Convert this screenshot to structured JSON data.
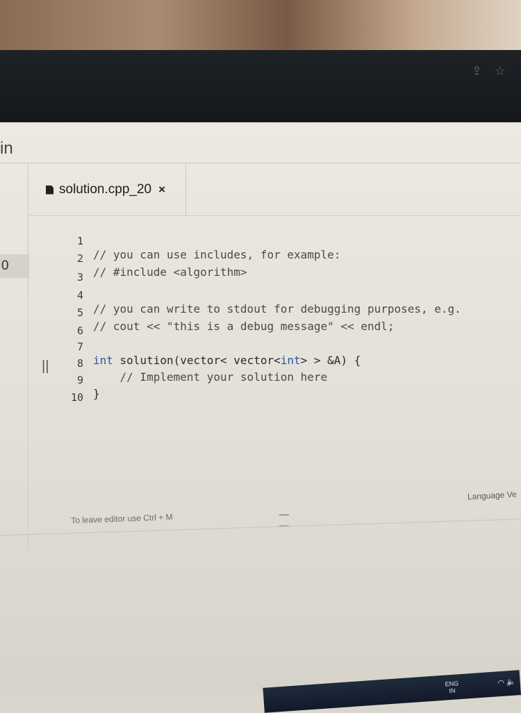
{
  "browser": {
    "share_icon": "share-icon",
    "star_icon": "star-icon"
  },
  "left_panel": {
    "edge_text": "in",
    "count": "0"
  },
  "editor": {
    "tab": {
      "label": "solution.cpp_20",
      "close": "×"
    },
    "lines": [
      {
        "num": "1",
        "text": "// you can use includes, for example:"
      },
      {
        "num": "2",
        "text": "// #include <algorithm>"
      },
      {
        "num": "3",
        "text": ""
      },
      {
        "num": "4",
        "text": "// you can write to stdout for debugging purposes, e.g."
      },
      {
        "num": "5",
        "text": "// cout << \"this is a debug message\" << endl;"
      },
      {
        "num": "6",
        "text": ""
      },
      {
        "num": "7",
        "text_kw1": "int",
        "text_mid": " solution(vector< vector<",
        "text_kw2": "int",
        "text_end": "> > &A) {"
      },
      {
        "num": "8",
        "text": "    // Implement your solution here"
      },
      {
        "num": "9",
        "text": "}"
      },
      {
        "num": "10",
        "text": ""
      }
    ],
    "hint": "To leave editor use Ctrl + M",
    "language_label": "Language Ve"
  },
  "taskbar": {
    "lang_line1": "ENG",
    "lang_line2": "IN",
    "icons": "wifi-icon volume-icon"
  },
  "colors": {
    "keyword": "#2f55a0",
    "page_bg": "#ece9e2",
    "dark_bar": "#1e2226"
  }
}
